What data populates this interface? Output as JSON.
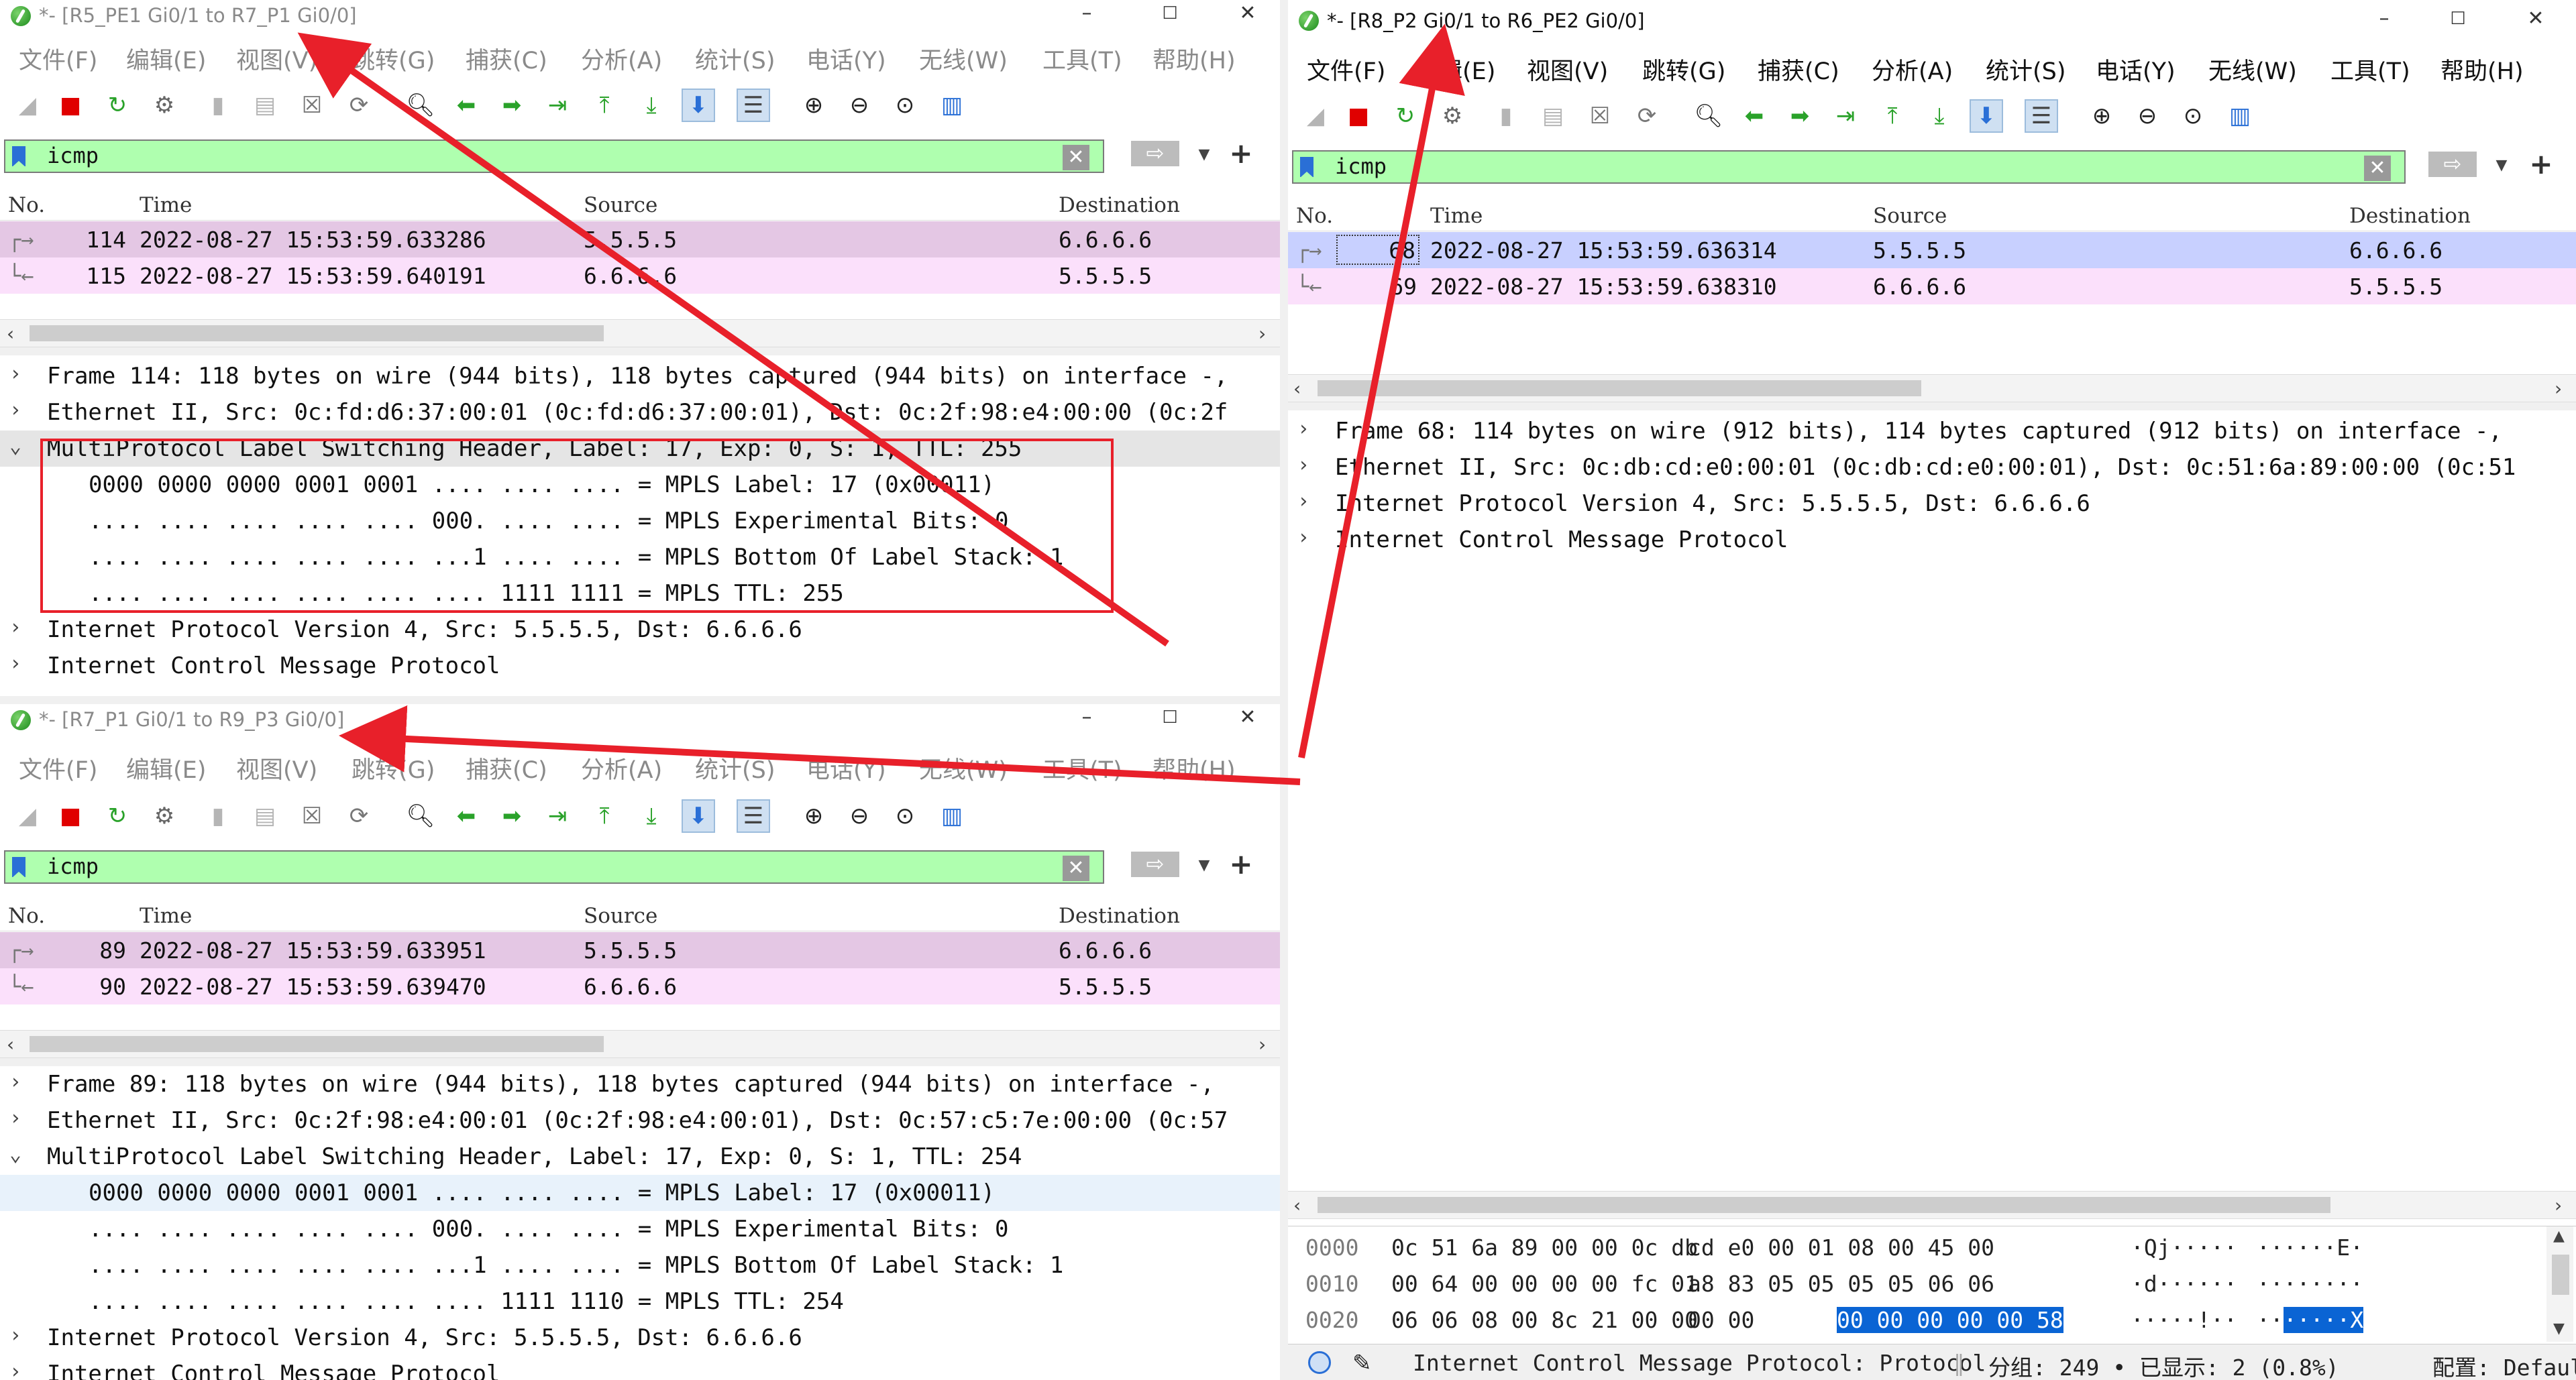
{
  "menus": [
    "文件(F)",
    "编辑(E)",
    "视图(V)",
    "跳转(G)",
    "捕获(C)",
    "分析(A)",
    "统计(S)",
    "电话(Y)",
    "无线(W)",
    "工具(T)",
    "帮助(H)"
  ],
  "window_controls": {
    "min": "–",
    "max": "☐",
    "close": "✕"
  },
  "columns": {
    "no": "No.",
    "time": "Time",
    "source": "Source",
    "destination": "Destination"
  },
  "filter": {
    "value": "icmp"
  },
  "expand_glyph": {
    "collapsed": "›",
    "expanded": "⌄"
  },
  "win1": {
    "title": "*- [R5_PE1 Gi0/1 to R7_P1 Gi0/0]",
    "packets": [
      {
        "no": "114",
        "time": "2022-08-27 15:53:59.633286",
        "src": "5.5.5.5",
        "dst": "6.6.6.6"
      },
      {
        "no": "115",
        "time": "2022-08-27 15:53:59.640191",
        "src": "6.6.6.6",
        "dst": "5.5.5.5"
      }
    ],
    "details": [
      {
        "text": "Frame 114: 118 bytes on wire (944 bits), 118 bytes captured (944 bits) on interface -,"
      },
      {
        "text": "Ethernet II, Src: 0c:fd:d6:37:00:01 (0c:fd:d6:37:00:01), Dst: 0c:2f:98:e4:00:00 (0c:2f"
      },
      {
        "text": "MultiProtocol Label Switching Header, Label: 17, Exp: 0, S: 1, TTL: 255"
      },
      {
        "text": "0000 0000 0000 0001 0001 .... .... .... = MPLS Label: 17 (0x00011)"
      },
      {
        "text": ".... .... .... .... .... 000. .... .... = MPLS Experimental Bits: 0"
      },
      {
        "text": ".... .... .... .... .... ...1 .... .... = MPLS Bottom Of Label Stack: 1"
      },
      {
        "text": ".... .... .... .... .... .... 1111 1111 = MPLS TTL: 255"
      },
      {
        "text": "Internet Protocol Version 4, Src: 5.5.5.5, Dst: 6.6.6.6"
      },
      {
        "text": "Internet Control Message Protocol"
      }
    ]
  },
  "win2": {
    "title": "*- [R7_P1 Gi0/1 to R9_P3 Gi0/0]",
    "packets": [
      {
        "no": "89",
        "time": "2022-08-27 15:53:59.633951",
        "src": "5.5.5.5",
        "dst": "6.6.6.6"
      },
      {
        "no": "90",
        "time": "2022-08-27 15:53:59.639470",
        "src": "6.6.6.6",
        "dst": "5.5.5.5"
      }
    ],
    "details": [
      {
        "text": "Frame 89: 118 bytes on wire (944 bits), 118 bytes captured (944 bits) on interface -,"
      },
      {
        "text": "Ethernet II, Src: 0c:2f:98:e4:00:01 (0c:2f:98:e4:00:01), Dst: 0c:57:c5:7e:00:00 (0c:57"
      },
      {
        "text": "MultiProtocol Label Switching Header, Label: 17, Exp: 0, S: 1, TTL: 254"
      },
      {
        "text": "0000 0000 0000 0001 0001 .... .... .... = MPLS Label: 17 (0x00011)"
      },
      {
        "text": ".... .... .... .... .... 000. .... .... = MPLS Experimental Bits: 0"
      },
      {
        "text": ".... .... .... .... .... ...1 .... .... = MPLS Bottom Of Label Stack: 1"
      },
      {
        "text": ".... .... .... .... .... .... 1111 1110 = MPLS TTL: 254"
      },
      {
        "text": "Internet Protocol Version 4, Src: 5.5.5.5, Dst: 6.6.6.6"
      },
      {
        "text": "Internet Control Message Protocol"
      }
    ]
  },
  "win3": {
    "title": "*- [R8_P2 Gi0/1 to R6_PE2 Gi0/0]",
    "packets": [
      {
        "no": "68",
        "time": "2022-08-27 15:53:59.636314",
        "src": "5.5.5.5",
        "dst": "6.6.6.6"
      },
      {
        "no": "69",
        "time": "2022-08-27 15:53:59.638310",
        "src": "6.6.6.6",
        "dst": "5.5.5.5"
      }
    ],
    "details": [
      {
        "text": "Frame 68: 114 bytes on wire (912 bits), 114 bytes captured (912 bits) on interface -,"
      },
      {
        "text": "Ethernet II, Src: 0c:db:cd:e0:00:01 (0c:db:cd:e0:00:01), Dst: 0c:51:6a:89:00:00 (0c:51"
      },
      {
        "text": "Internet Protocol Version 4, Src: 5.5.5.5, Dst: 6.6.6.6"
      },
      {
        "text": "Internet Control Message Protocol"
      }
    ],
    "hex": [
      {
        "off": "0000",
        "a": "0c 51 6a 89 00 00 0c db",
        "b": "cd e0 00 01 08 00 45 00",
        "b_sel": "",
        "ascii": "·Qj·····",
        "ascii2": "······E·",
        "ascii2_sel": ""
      },
      {
        "off": "0010",
        "a": "00 64 00 00 00 00 fc 01",
        "b": "a8 83 05 05 05 05 06 06",
        "b_sel": "",
        "ascii": "·d······",
        "ascii2": "········",
        "ascii2_sel": ""
      },
      {
        "off": "0020",
        "a": "06 06 08 00 8c 21 00 00",
        "b": "00 00",
        "b_sel": "00 00 00 00 00 58",
        "ascii": "·····!··",
        "ascii2": "··",
        "ascii2_sel": "·····X"
      }
    ],
    "status": {
      "protocol": "Internet Control Message Protocol: Protocol",
      "packets": "分组: 249 • 已显示: 2 (0.8%)",
      "profile": "配置: Default"
    }
  },
  "colors": {
    "row_echo_request": "#e4c7e4",
    "row_echo_reply": "#fbe0fb",
    "row_selected": "#c8d0ff",
    "annotation": "#e8202a",
    "filter_bg": "#afffaf"
  }
}
